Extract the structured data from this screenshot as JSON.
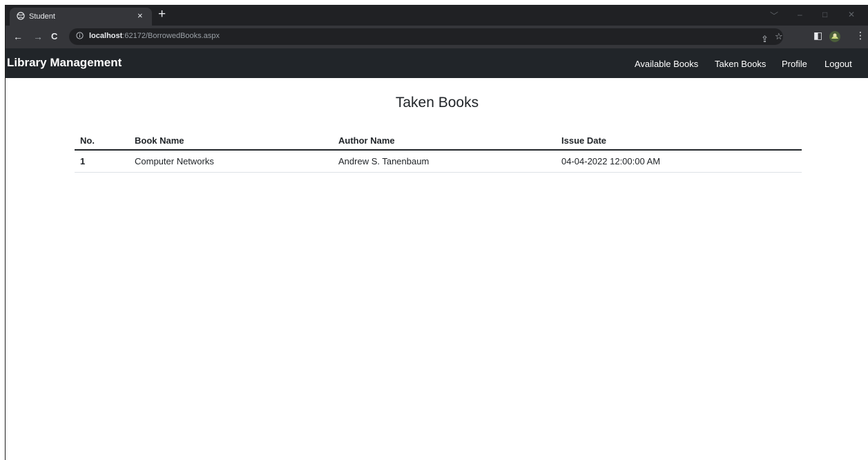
{
  "browser": {
    "tab_title": "Student",
    "tab_close": "×",
    "new_tab": "+",
    "url_host": "localhost",
    "url_path": ":62172/BorrowedBooks.aspx",
    "nav": {
      "back": "←",
      "forward": "→",
      "reload": "C"
    },
    "window_controls": {
      "chevron": "﹀",
      "minimize": "–",
      "maximize": "□",
      "close": "✕"
    },
    "toolbar": {
      "share": "⇪",
      "star": "☆",
      "sidepanel": "◧",
      "menu": "⋮"
    }
  },
  "site": {
    "brand": "Library Management",
    "nav_links": [
      {
        "label": "Available Books"
      },
      {
        "label": "Taken Books"
      },
      {
        "label": "Profile"
      },
      {
        "label": "Logout"
      }
    ]
  },
  "page": {
    "title": "Taken Books",
    "table": {
      "headers": [
        "No.",
        "Book Name",
        "Author Name",
        "Issue Date"
      ],
      "rows": [
        [
          "1",
          "Computer Networks",
          "Andrew S. Tanenbaum",
          "04-04-2022 12:00:00 AM"
        ]
      ]
    }
  },
  "colors": {
    "tabstrip": "#202124",
    "toolbar": "#35363a",
    "navbar": "#212529",
    "text": "#212529"
  }
}
